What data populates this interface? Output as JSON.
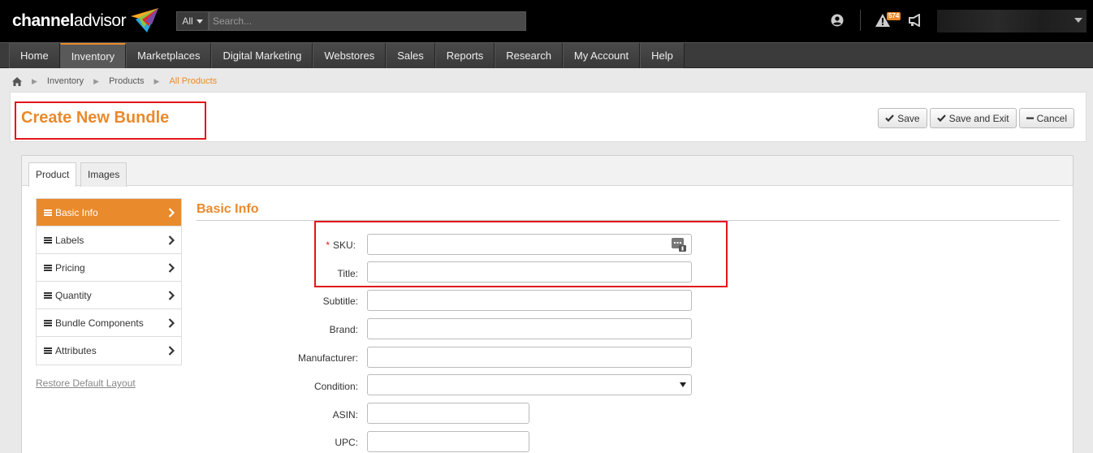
{
  "topbar": {
    "logo_text_bold": "channel",
    "logo_text_rest": "advisor",
    "search_scope": "All",
    "search_placeholder": "Search...",
    "alert_count": "574"
  },
  "nav": {
    "items": [
      {
        "label": "Home"
      },
      {
        "label": "Inventory"
      },
      {
        "label": "Marketplaces"
      },
      {
        "label": "Digital Marketing"
      },
      {
        "label": "Webstores"
      },
      {
        "label": "Sales"
      },
      {
        "label": "Reports"
      },
      {
        "label": "Research"
      },
      {
        "label": "My Account"
      },
      {
        "label": "Help"
      }
    ],
    "active": "Inventory"
  },
  "breadcrumb": {
    "items": [
      "Inventory",
      "Products",
      "All Products"
    ]
  },
  "header": {
    "title": "Create New Bundle",
    "save_label": "Save",
    "save_exit_label": "Save and Exit",
    "cancel_label": "Cancel"
  },
  "tabs": [
    {
      "label": "Product"
    },
    {
      "label": "Images"
    }
  ],
  "side_menu": {
    "items": [
      {
        "label": "Basic Info"
      },
      {
        "label": "Labels"
      },
      {
        "label": "Pricing"
      },
      {
        "label": "Quantity"
      },
      {
        "label": "Bundle Components"
      },
      {
        "label": "Attributes"
      }
    ],
    "restore_link": "Restore Default Layout"
  },
  "form": {
    "section_title": "Basic Info",
    "required_marker": "*",
    "fields": {
      "sku": {
        "label": "SKU:",
        "value": ""
      },
      "title": {
        "label": "Title:",
        "value": ""
      },
      "subtitle": {
        "label": "Subtitle:",
        "value": ""
      },
      "brand": {
        "label": "Brand:",
        "value": ""
      },
      "manufacturer": {
        "label": "Manufacturer:",
        "value": ""
      },
      "condition": {
        "label": "Condition:",
        "value": ""
      },
      "asin": {
        "label": "ASIN:",
        "value": ""
      },
      "upc": {
        "label": "UPC:",
        "value": ""
      }
    }
  },
  "colors": {
    "accent": "#e98a2c",
    "highlight": "#e3151a",
    "topbar": "#000000",
    "navbar": "#3b3b3b"
  }
}
